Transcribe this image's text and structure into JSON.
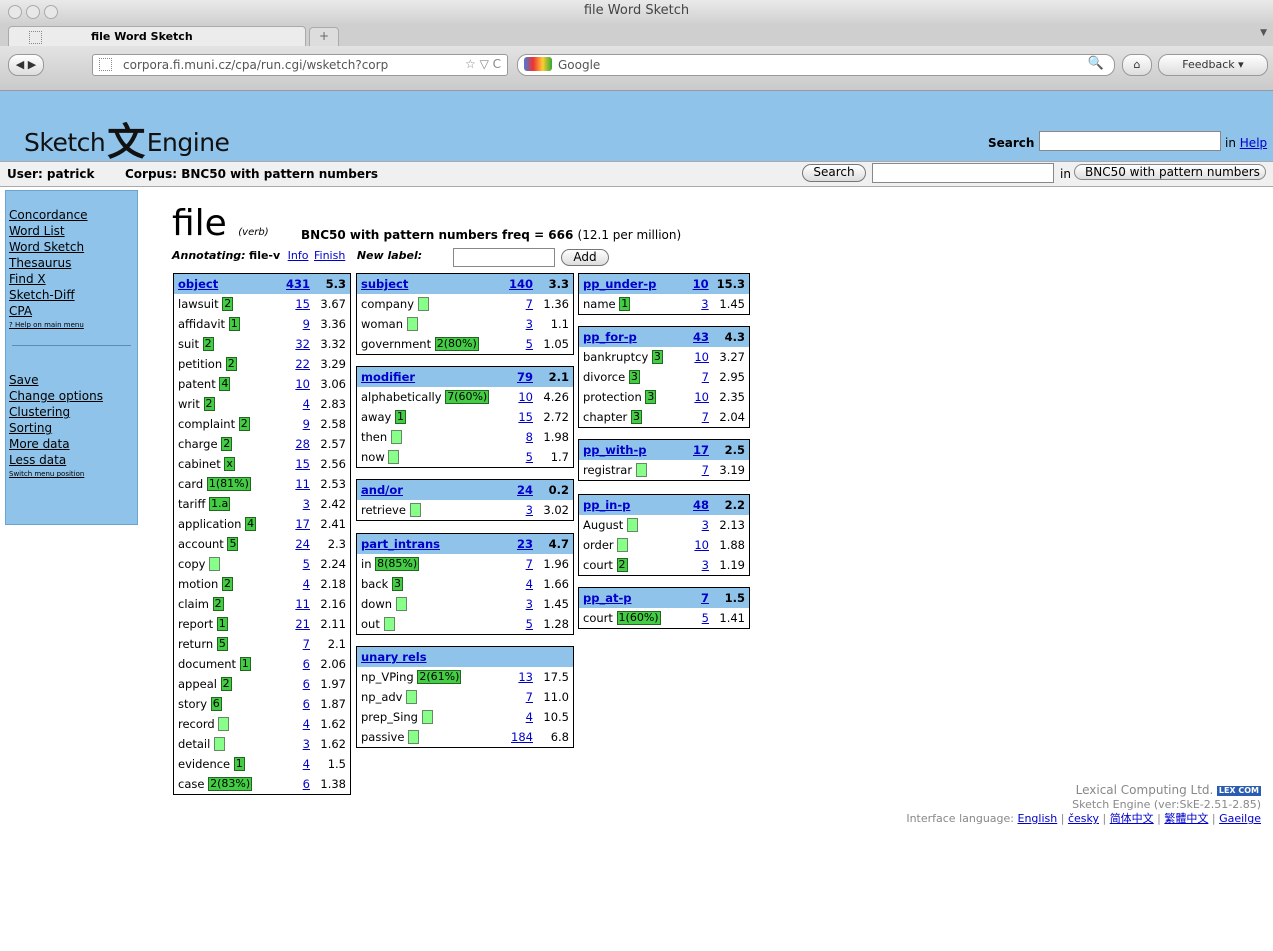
{
  "window_title": "file Word Sketch",
  "tab_title": "file Word Sketch",
  "url": "corpora.fi.muni.cz/cpa/run.cgi/wsketch?corp",
  "google_placeholder": "Google",
  "feedback": "Feedback",
  "header": {
    "logo_left": "Sketch",
    "logo_char": "文",
    "logo_right": "Engine",
    "search_label": "Search",
    "in_text": "in",
    "help": "Help"
  },
  "userbar": {
    "user": "User: patrick",
    "corpus": "Corpus: BNC50 with pattern numbers",
    "search_btn": "Search",
    "in_text": "in",
    "select": "BNC50 with pattern numbers"
  },
  "sidebar": {
    "items": [
      "Concordance",
      "Word List",
      "Word Sketch",
      "Thesaurus",
      "Find X",
      "Sketch-Diff",
      "CPA"
    ],
    "help": "? Help on main menu",
    "items2": [
      "Save",
      "Change options",
      "Clustering",
      "Sorting",
      "More data",
      "Less data"
    ],
    "switch": "Switch menu position"
  },
  "headword": {
    "word": "file",
    "pos": "(verb)",
    "freq_label": "BNC50 with pattern numbers freq = 666",
    "per_million": "(12.1 per million)"
  },
  "annotating": {
    "label": "Annotating:",
    "value": "file-v",
    "info": "Info",
    "finish": "Finish",
    "new_label": "New label:",
    "add": "Add"
  },
  "tables": [
    {
      "name": "object",
      "count": "431",
      "score": "5.3",
      "rows": [
        [
          "lawsuit",
          "2",
          "15",
          "3.67"
        ],
        [
          "affidavit",
          "1",
          "9",
          "3.36"
        ],
        [
          "suit",
          "2",
          "32",
          "3.32"
        ],
        [
          "petition",
          "2",
          "22",
          "3.29"
        ],
        [
          "patent",
          "4",
          "10",
          "3.06"
        ],
        [
          "writ",
          "2",
          "4",
          "2.83"
        ],
        [
          "complaint",
          "2",
          "9",
          "2.58"
        ],
        [
          "charge",
          "2",
          "28",
          "2.57"
        ],
        [
          "cabinet",
          "x",
          "15",
          "2.56"
        ],
        [
          "card",
          "1(81%)",
          "11",
          "2.53"
        ],
        [
          "tariff",
          "1.a",
          "3",
          "2.42"
        ],
        [
          "application",
          "4",
          "17",
          "2.41"
        ],
        [
          "account",
          "5",
          "24",
          "2.3"
        ],
        [
          "copy",
          "",
          "5",
          "2.24"
        ],
        [
          "motion",
          "2",
          "4",
          "2.18"
        ],
        [
          "claim",
          "2",
          "11",
          "2.16"
        ],
        [
          "report",
          "1",
          "21",
          "2.11"
        ],
        [
          "return",
          "5",
          "7",
          "2.1"
        ],
        [
          "document",
          "1",
          "6",
          "2.06"
        ],
        [
          "appeal",
          "2",
          "6",
          "1.97"
        ],
        [
          "story",
          "6",
          "6",
          "1.87"
        ],
        [
          "record",
          "",
          "4",
          "1.62"
        ],
        [
          "detail",
          "",
          "3",
          "1.62"
        ],
        [
          "evidence",
          "1",
          "4",
          "1.5"
        ],
        [
          "case",
          "2(83%)",
          "6",
          "1.38"
        ]
      ]
    },
    {
      "name": "subject",
      "count": "140",
      "score": "3.3",
      "rows": [
        [
          "company",
          "",
          "7",
          "1.36"
        ],
        [
          "woman",
          "",
          "3",
          "1.1"
        ],
        [
          "government",
          "2(80%)",
          "5",
          "1.05"
        ]
      ]
    },
    {
      "name": "modifier",
      "count": "79",
      "score": "2.1",
      "rows": [
        [
          "alphabetically",
          "7(60%)",
          "10",
          "4.26"
        ],
        [
          "away",
          "1",
          "15",
          "2.72"
        ],
        [
          "then",
          "",
          "8",
          "1.98"
        ],
        [
          "now",
          "",
          "5",
          "1.7"
        ]
      ]
    },
    {
      "name": "and/or",
      "count": "24",
      "score": "0.2",
      "rows": [
        [
          "retrieve",
          "",
          "3",
          "3.02"
        ]
      ]
    },
    {
      "name": "part_intrans",
      "count": "23",
      "score": "4.7",
      "rows": [
        [
          "in",
          "8(85%)",
          "7",
          "1.96"
        ],
        [
          "back",
          "3",
          "4",
          "1.66"
        ],
        [
          "down",
          "",
          "3",
          "1.45"
        ],
        [
          "out",
          "",
          "5",
          "1.28"
        ]
      ]
    },
    {
      "name": "unary rels",
      "count": "",
      "score": "",
      "rows": [
        [
          "np_VPing",
          "2(61%)",
          "13",
          "17.5"
        ],
        [
          "np_adv",
          "",
          "7",
          "11.0"
        ],
        [
          "prep_Sing",
          "",
          "4",
          "10.5"
        ],
        [
          "passive",
          "",
          "184",
          "6.8"
        ]
      ]
    },
    {
      "name": "pp_under-p",
      "count": "10",
      "score": "15.3",
      "rows": [
        [
          "name",
          "1",
          "3",
          "1.45"
        ]
      ]
    },
    {
      "name": "pp_for-p",
      "count": "43",
      "score": "4.3",
      "rows": [
        [
          "bankruptcy",
          "3",
          "10",
          "3.27"
        ],
        [
          "divorce",
          "3",
          "7",
          "2.95"
        ],
        [
          "protection",
          "3",
          "10",
          "2.35"
        ],
        [
          "chapter",
          "3",
          "7",
          "2.04"
        ]
      ]
    },
    {
      "name": "pp_with-p",
      "count": "17",
      "score": "2.5",
      "rows": [
        [
          "registrar",
          "",
          "7",
          "3.19"
        ]
      ]
    },
    {
      "name": "pp_in-p",
      "count": "48",
      "score": "2.2",
      "rows": [
        [
          "August",
          "",
          "3",
          "2.13"
        ],
        [
          "order",
          "",
          "10",
          "1.88"
        ],
        [
          "court",
          "2",
          "3",
          "1.19"
        ]
      ]
    },
    {
      "name": "pp_at-p",
      "count": "7",
      "score": "1.5",
      "rows": [
        [
          "court",
          "1(60%)",
          "5",
          "1.41"
        ]
      ]
    }
  ],
  "footer": {
    "company": "Lexical Computing Ltd.",
    "badge": "LEX COM",
    "version": "Sketch Engine (ver:SkE-2.51-2.85)",
    "lang_label": "Interface language:",
    "langs": [
      "English",
      "česky",
      "简体中文",
      "繁體中文",
      "Gaeilge"
    ]
  }
}
